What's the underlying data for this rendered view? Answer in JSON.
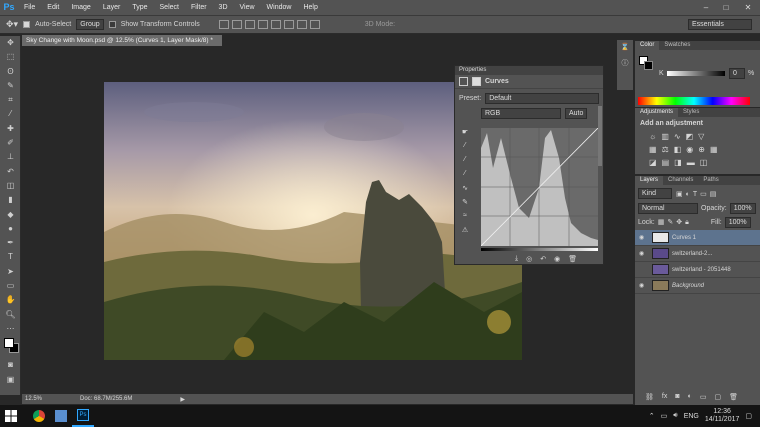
{
  "app": {
    "logo": "Ps"
  },
  "menu": [
    "File",
    "Edit",
    "Image",
    "Layer",
    "Type",
    "Select",
    "Filter",
    "3D",
    "View",
    "Window",
    "Help"
  ],
  "window_controls": {
    "minimize": "–",
    "maximize": "□",
    "close": "✕"
  },
  "options": {
    "auto_select": "Auto-Select",
    "group": "Group",
    "transform": "Show Transform Controls",
    "mode3d": "3D Mode:",
    "workspace": "Essentials"
  },
  "document": {
    "tab_title": "Sky Change with Moon.psd @ 12.5% (Curves 1, Layer Mask/8) *"
  },
  "status": {
    "zoom": "12.5%",
    "doc": "Doc: 68.7M/255.6M"
  },
  "properties": {
    "tab": "Properties",
    "title": "Curves",
    "preset_label": "Preset:",
    "preset_value": "Default",
    "channel": "RGB",
    "auto": "Auto"
  },
  "color_panel": {
    "tabs": [
      "Color",
      "Swatches"
    ],
    "k_label": "K",
    "k_value": "0",
    "k_unit": "%"
  },
  "adjustments": {
    "tabs": [
      "Adjustments",
      "Styles"
    ],
    "add_label": "Add an adjustment"
  },
  "layers_panel": {
    "tabs": [
      "Layers",
      "Channels",
      "Paths"
    ],
    "kind": "Kind",
    "blend": "Normal",
    "opacity_label": "Opacity:",
    "opacity": "100%",
    "lock_label": "Lock:",
    "fill_label": "Fill:",
    "fill": "100%",
    "layers": [
      {
        "name": "Curves 1",
        "visible": true,
        "selected": true,
        "thumb": "#e8e8e8"
      },
      {
        "name": "switzerland-2...",
        "visible": true,
        "selected": false,
        "thumb": "#5a4a8a"
      },
      {
        "name": "switzerland - 2051448",
        "visible": false,
        "selected": false,
        "thumb": "#6a5a9a"
      },
      {
        "name": "Background",
        "visible": true,
        "selected": false,
        "thumb": "#8a7a5a"
      }
    ]
  },
  "taskbar": {
    "lang": "ENG",
    "time": "12:36",
    "date": "14/11/2017"
  },
  "colors": {
    "accent": "#31a8ff",
    "panel": "#535353",
    "selected": "#5d738e"
  }
}
